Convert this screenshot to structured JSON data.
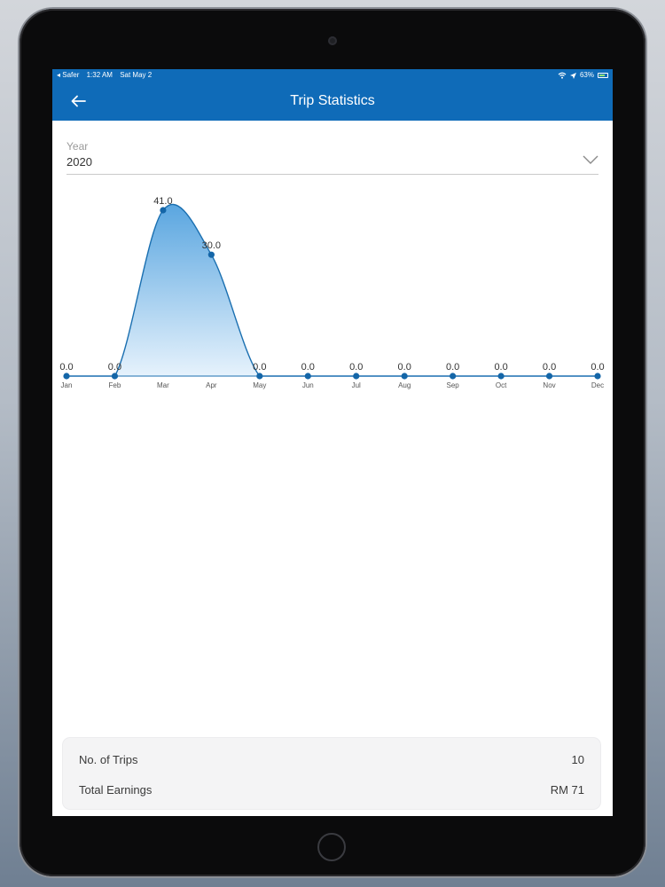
{
  "status_bar": {
    "carrier": "◂ Safer",
    "time": "1:32 AM",
    "date": "Sat May 2",
    "battery": "63%"
  },
  "app_bar": {
    "title": "Trip Statistics",
    "back_icon": "arrow-left-icon"
  },
  "year_selector": {
    "label": "Year",
    "value": "2020",
    "icon": "chevron-down-icon"
  },
  "chart_data": {
    "type": "area",
    "categories": [
      "Jan",
      "Feb",
      "Mar",
      "Apr",
      "May",
      "Jun",
      "Jul",
      "Aug",
      "Sep",
      "Oct",
      "Nov",
      "Dec"
    ],
    "values": [
      0,
      0,
      41,
      30,
      0,
      0,
      0,
      0,
      0,
      0,
      0,
      0
    ],
    "data_labels": [
      "0.0",
      "0.0",
      "41.0",
      "30.0",
      "0.0",
      "0.0",
      "0.0",
      "0.0",
      "0.0",
      "0.0",
      "0.0",
      "0.0"
    ],
    "ylim": [
      0,
      41
    ],
    "grid": false,
    "colors": {
      "line": "#1a6fb0",
      "point": "#1466a8",
      "fill_top": "#5aa6e0",
      "fill_bottom": "#e6f2fc",
      "baseline": "#1a6fb0"
    }
  },
  "summary": {
    "trips_label": "No. of Trips",
    "trips_value": "10",
    "earnings_label": "Total Earnings",
    "earnings_value": "RM 71"
  },
  "colors": {
    "primary": "#0f6bb8"
  }
}
